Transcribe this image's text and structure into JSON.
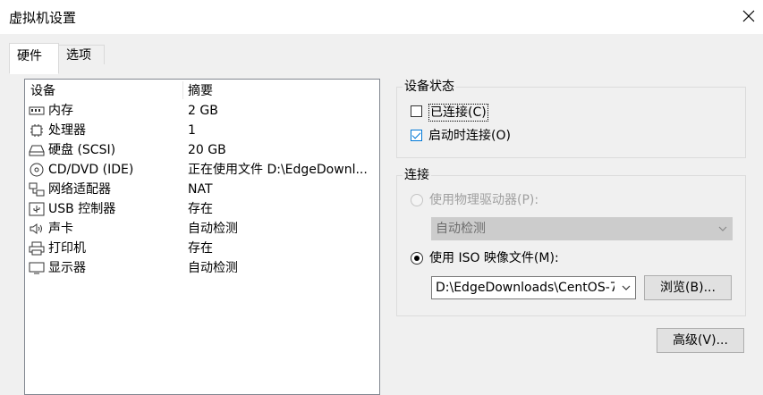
{
  "window": {
    "title": "虚拟机设置"
  },
  "tabs": [
    {
      "label": "硬件",
      "active": true
    },
    {
      "label": "选项",
      "active": false
    }
  ],
  "devices": {
    "columns": [
      "设备",
      "摘要"
    ],
    "rows": [
      {
        "name": "内存",
        "summary": "2 GB",
        "icon": "memory-icon"
      },
      {
        "name": "处理器",
        "summary": "1",
        "icon": "processor-icon"
      },
      {
        "name": "硬盘 (SCSI)",
        "summary": "20 GB",
        "icon": "hard-disk-icon"
      },
      {
        "name": "CD/DVD (IDE)",
        "summary": "正在使用文件 D:\\EdgeDownl...",
        "icon": "cd-dvd-icon"
      },
      {
        "name": "网络适配器",
        "summary": "NAT",
        "icon": "network-adapter-icon"
      },
      {
        "name": "USB 控制器",
        "summary": "存在",
        "icon": "usb-icon"
      },
      {
        "name": "声卡",
        "summary": "自动检测",
        "icon": "speaker-icon"
      },
      {
        "name": "打印机",
        "summary": "存在",
        "icon": "printer-icon"
      },
      {
        "name": "显示器",
        "summary": "自动检测",
        "icon": "display-icon"
      }
    ]
  },
  "device_status": {
    "title": "设备状态",
    "connected": {
      "label": "已连接(C)",
      "checked": false
    },
    "connect_at_power_on": {
      "label": "启动时连接(O)",
      "checked": true
    }
  },
  "connection": {
    "title": "连接",
    "physical_drive": {
      "label": "使用物理驱动器(P):",
      "selected": false,
      "enabled": false,
      "value": "自动检测"
    },
    "iso_image": {
      "label": "使用 ISO 映像文件(M):",
      "selected": true,
      "value": "D:\\EdgeDownloads\\CentOS-7-›"
    },
    "browse_label": "浏览(B)..."
  },
  "advanced_label": "高级(V)...",
  "colors": {
    "accent": "#0078d7",
    "dialog_bg": "#f0f0f0",
    "disabled_combo": "#cccccc"
  }
}
